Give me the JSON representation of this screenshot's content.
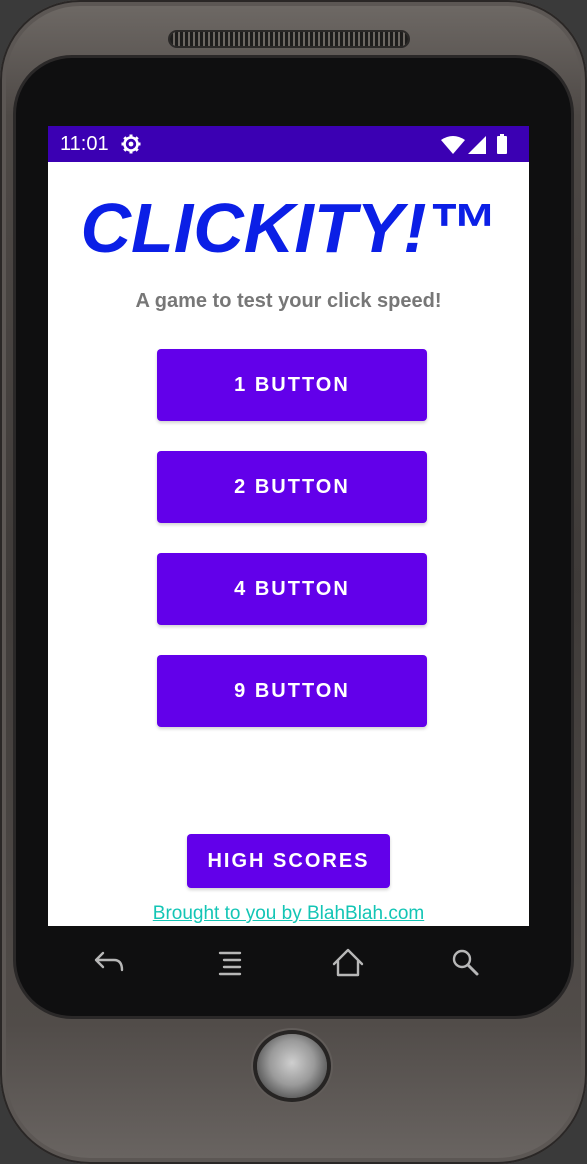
{
  "status_bar": {
    "time": "11:01",
    "settings_icon": "gear-icon",
    "wifi_icon": "wifi-icon",
    "signal_icon": "signal-icon",
    "battery_icon": "battery-icon",
    "background_color": "#3b00b3"
  },
  "app": {
    "title": "CLICKITY!™",
    "subtitle": "A game to test your click speed!",
    "title_color": "#0b1fe6",
    "accent_color": "#6200ea",
    "buttons": [
      {
        "label": "1 BUTTON"
      },
      {
        "label": "2 BUTTON"
      },
      {
        "label": "4 BUTTON"
      },
      {
        "label": "9 BUTTON"
      }
    ],
    "high_scores_label": "HIGH SCORES",
    "credit_link": "Brought to you by BlahBlah.com",
    "link_color": "#13c5b5"
  },
  "nav_bar": {
    "icons": [
      "back-icon",
      "menu-icon",
      "home-icon",
      "search-icon"
    ]
  }
}
